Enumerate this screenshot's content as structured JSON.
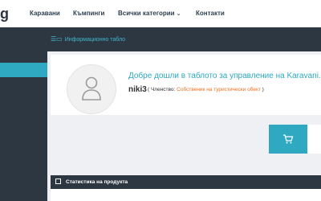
{
  "header": {
    "logo": "g",
    "nav": {
      "caravans": "Каравани",
      "campings": "Къмпинги",
      "all_categories": "Всички категории",
      "contacts": "Контакти"
    }
  },
  "dashboard": {
    "title": "Информационно табло"
  },
  "profile": {
    "welcome": "Добре дошли в таблото за управление на Karavani.bg",
    "username": "niki3",
    "membership_prefix": "( Членство: ",
    "membership_type": "Собственик на туристически обект",
    "membership_suffix": " )"
  },
  "stats": {
    "title": "Статистика на продукта"
  },
  "colors": {
    "accent": "#2ea9c1",
    "dark": "#2c3742",
    "orange": "#f37021"
  },
  "icons": [
    "user-avatar-icon",
    "monitor-icon",
    "cart-icon",
    "stats-icon",
    "chevron-down-icon"
  ]
}
